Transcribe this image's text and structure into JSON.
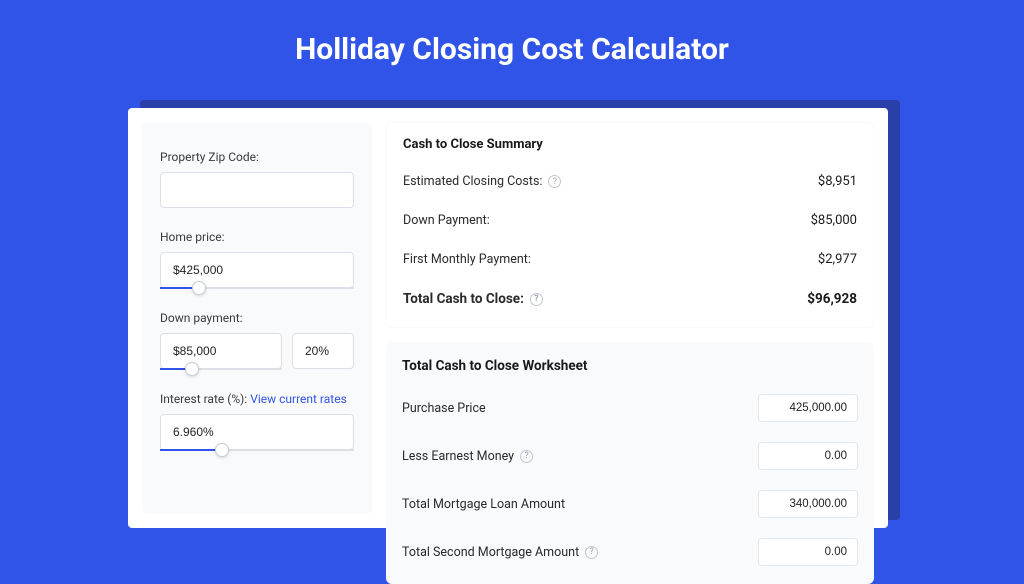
{
  "title": "Holliday Closing Cost Calculator",
  "sidebar": {
    "zip_label": "Property Zip Code:",
    "zip_value": "",
    "home_price_label": "Home price:",
    "home_price_value": "$425,000",
    "home_price_slider_pct": 20,
    "down_payment_label": "Down payment:",
    "down_payment_value": "$85,000",
    "down_payment_pct": "20%",
    "down_payment_slider_pct": 26,
    "interest_label": "Interest rate (%):",
    "interest_link": "View current rates",
    "interest_value": "6.960%",
    "interest_slider_pct": 32
  },
  "summary": {
    "header": "Cash to Close Summary",
    "rows": [
      {
        "label": "Estimated Closing Costs:",
        "value": "$8,951",
        "help": true
      },
      {
        "label": "Down Payment:",
        "value": "$85,000",
        "help": false
      },
      {
        "label": "First Monthly Payment:",
        "value": "$2,977",
        "help": false
      }
    ],
    "total_label": "Total Cash to Close:",
    "total_value": "$96,928"
  },
  "worksheet": {
    "header": "Total Cash to Close Worksheet",
    "rows": [
      {
        "label": "Purchase Price",
        "value": "425,000.00",
        "help": false
      },
      {
        "label": "Less Earnest Money",
        "value": "0.00",
        "help": true
      },
      {
        "label": "Total Mortgage Loan Amount",
        "value": "340,000.00",
        "help": false
      },
      {
        "label": "Total Second Mortgage Amount",
        "value": "0.00",
        "help": true
      }
    ]
  }
}
